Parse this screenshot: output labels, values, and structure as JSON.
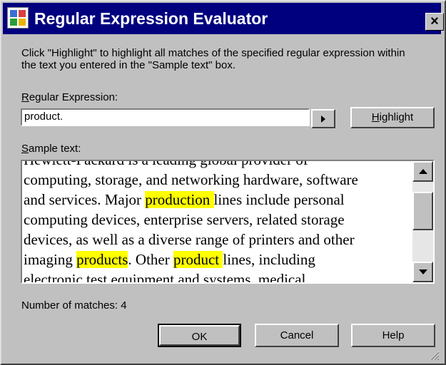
{
  "window": {
    "title": "Regular Expression Evaluator",
    "close_label": "×"
  },
  "intro_text": "Click \"Highlight\" to highlight all matches of the specified regular expression within the text you entered in the \"Sample text\" box.",
  "regex": {
    "label_mnemonic": "R",
    "label_rest": "egular Expression:",
    "value": "product."
  },
  "highlight_button": {
    "pre": "",
    "mnemonic": "H",
    "post": "ighlight"
  },
  "sample": {
    "label_mnemonic": "S",
    "label_rest": "ample text:",
    "lines": [
      [
        {
          "t": "Hewlett-Packard is a leading global provider of"
        }
      ],
      [
        {
          "t": "computing, storage, and networking hardware, software"
        }
      ],
      [
        {
          "t": "and services. Major "
        },
        {
          "t": "production ",
          "h": true
        },
        {
          "t": "lines include personal"
        }
      ],
      [
        {
          "t": "computing devices, enterprise servers, related storage"
        }
      ],
      [
        {
          "t": "devices, as well as a diverse range of printers and other"
        }
      ],
      [
        {
          "t": "imaging "
        },
        {
          "t": "products",
          "h": true
        },
        {
          "t": ". Other "
        },
        {
          "t": "product ",
          "h": true
        },
        {
          "t": "lines, including"
        }
      ],
      [
        {
          "t": "electronic test equipment and systems, medical"
        }
      ]
    ]
  },
  "matches": {
    "text": "Number of matches: 4"
  },
  "buttons": {
    "ok": "OK",
    "cancel": "Cancel",
    "help": "Help"
  },
  "colors": {
    "highlight": "#ffff00",
    "titlebar": "#00007f",
    "face": "#c0c0c0"
  }
}
